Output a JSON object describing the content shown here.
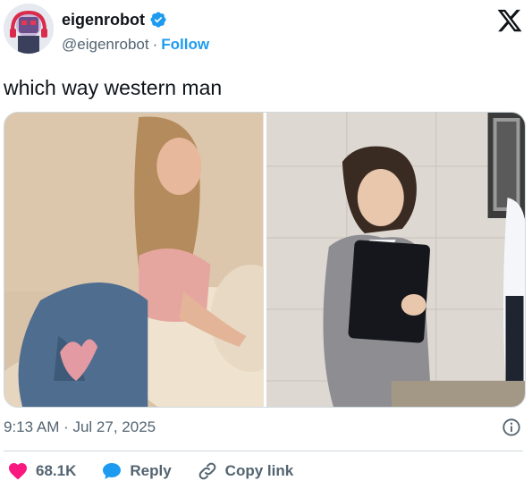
{
  "author": {
    "name": "eigenrobot",
    "handle": "@eigenrobot",
    "separator": "·",
    "follow_label": "Follow",
    "verified": true
  },
  "tweet": {
    "text": "which way western man",
    "timestamp": "9:13 AM · Jul 27, 2025"
  },
  "actions": {
    "likes_count": "68.1K",
    "reply_label": "Reply",
    "copy_link_label": "Copy link"
  },
  "icons": {
    "verified": "verified-badge-icon",
    "brand": "x-logo-icon",
    "info": "info-icon",
    "like": "heart-icon",
    "reply": "reply-bubble-icon",
    "link": "link-icon"
  },
  "colors": {
    "accent": "#1d9bf0",
    "like": "#f91880",
    "muted": "#536471"
  }
}
